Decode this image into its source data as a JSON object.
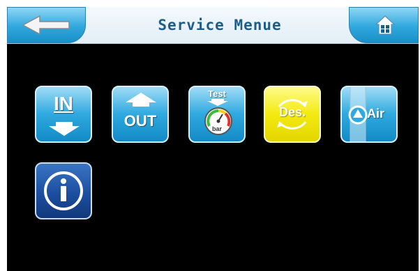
{
  "header": {
    "title": "Service Menue",
    "back_icon": "back-arrow-icon",
    "home_icon": "home-icon"
  },
  "menu": {
    "items": [
      {
        "label": "IN",
        "icon": "water-in-icon",
        "color": "#2fa9df"
      },
      {
        "label": "OUT",
        "icon": "water-out-icon",
        "color": "#2fa9df"
      },
      {
        "label": "Test",
        "sublabel": "bar",
        "icon": "pressure-test-gauge-icon",
        "color": "#2fa9df"
      },
      {
        "label": "Des.",
        "icon": "disinfection-icon",
        "color": "#f4ea10"
      },
      {
        "label": "Air",
        "icon": "air-vent-icon",
        "color": "#2fa9df"
      },
      {
        "label": "",
        "icon": "info-icon",
        "color": "#1c4ea0"
      }
    ]
  },
  "colors": {
    "header_bg": "#e8f2f8",
    "accent_blue": "#2fa9df",
    "content_bg": "#000000",
    "title_text": "#1d5d86"
  }
}
